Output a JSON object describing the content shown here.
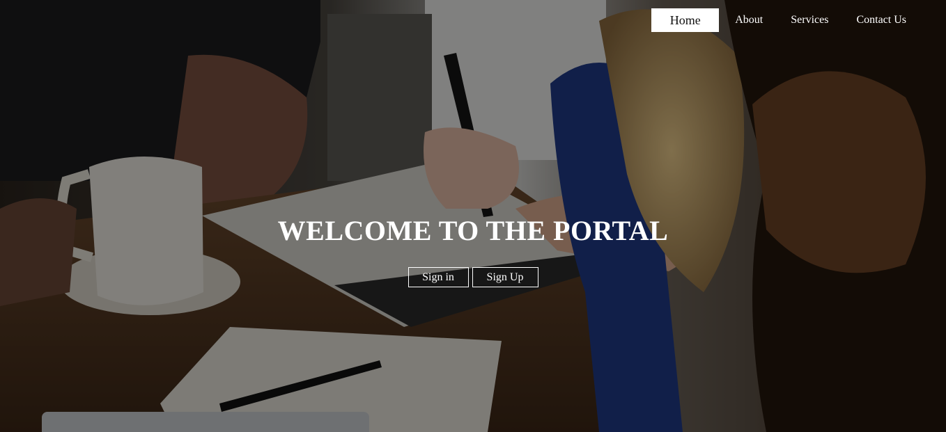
{
  "nav": {
    "items": [
      {
        "label": "Home",
        "active": true
      },
      {
        "label": "About",
        "active": false
      },
      {
        "label": "Services",
        "active": false
      },
      {
        "label": "Contact Us",
        "active": false
      }
    ]
  },
  "hero": {
    "title": "WELCOME TO THE PORTAL",
    "signin_label": "Sign in",
    "signup_label": "Sign Up"
  },
  "colors": {
    "overlay": "#000000",
    "text": "#ffffff",
    "nav_active_bg": "#ffffff",
    "nav_active_text": "#111111"
  },
  "background_image": {
    "icon": "hero-photo"
  }
}
